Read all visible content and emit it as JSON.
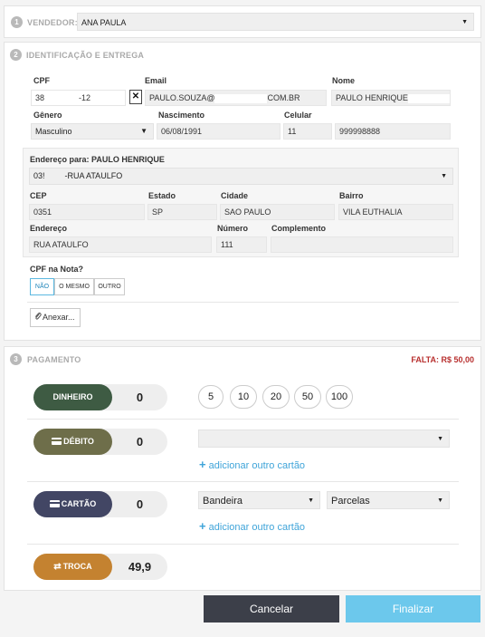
{
  "vendedor": {
    "step": "1",
    "label": "VENDEDOR:",
    "value": "ANA PAULA"
  },
  "identificacao": {
    "step": "2",
    "title": "IDENTIFICAÇÃO E ENTREGA",
    "cpf_label": "CPF",
    "cpf_start": "38",
    "cpf_end": "-12",
    "clear_glyph": "✕",
    "email_label": "Email",
    "email_start": "PAULO.SOUZA@",
    "email_end": "COM.BR",
    "nome_label": "Nome",
    "nome_value": "PAULO HENRIQUE",
    "genero_label": "Gênero",
    "genero_value": "Masculino",
    "nascimento_label": "Nascimento",
    "nascimento_value": "06/08/1991",
    "celular_label": "Celular",
    "celular_ddd": "11",
    "celular_number": "999998888"
  },
  "endereco": {
    "header": "Endereço para: PAULO HENRIQUE",
    "select_start": "03!",
    "select_end": "-RUA ATAULFO",
    "cep_label": "CEP",
    "cep_value": "0351",
    "estado_label": "Estado",
    "estado_value": "SP",
    "cidade_label": "Cidade",
    "cidade_value": "SAO PAULO",
    "bairro_label": "Bairro",
    "bairro_value": "VILA EUTHALIA",
    "endereco_label": "Endereço",
    "endereco_value": "RUA ATAULFO",
    "numero_label": "Número",
    "numero_value": "111",
    "complemento_label": "Complemento",
    "complemento_value": ""
  },
  "cpf_nota": {
    "label": "CPF na Nota?",
    "options": [
      "NÃO",
      "O MESMO",
      "OUTRO"
    ],
    "selected": "NÃO"
  },
  "anexar": {
    "label": "Anexar..."
  },
  "pagamento": {
    "step": "3",
    "title": "PAGAMENTO",
    "falta": "FALTA: R$ 50,00",
    "dinheiro": {
      "label": "DINHEIRO",
      "value": "0",
      "color": "#3e5b43"
    },
    "coins": [
      "5",
      "10",
      "20",
      "50",
      "100"
    ],
    "debito": {
      "label": "DÉBITO",
      "value": "0",
      "color": "#6e6e4a"
    },
    "cartao": {
      "label": "CARTÃO",
      "value": "0",
      "color": "#424664"
    },
    "troca": {
      "label": "TROCA",
      "value": "49,9",
      "color": "#c48230"
    },
    "add_card": "adicionar outro cartão",
    "bandeira_placeholder": "Bandeira",
    "parcelas_placeholder": "Parcelas"
  },
  "footer": {
    "cancel": "Cancelar",
    "finish": "Finalizar",
    "cancel_color": "#3c3f49",
    "finish_color": "#6cc8ec"
  }
}
